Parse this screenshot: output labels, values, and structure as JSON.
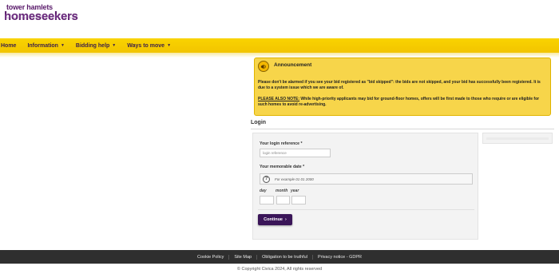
{
  "brand": {
    "logo_top": "tower hamlets",
    "logo_main": "homeseekers",
    "accent": "#f7c900",
    "brand_purple": "#5a1b6b"
  },
  "nav": {
    "items": [
      {
        "label": "Home",
        "has_dropdown": false
      },
      {
        "label": "Information",
        "has_dropdown": true
      },
      {
        "label": "Bidding help",
        "has_dropdown": true
      },
      {
        "label": "Ways to move",
        "has_dropdown": true
      }
    ]
  },
  "announcement": {
    "title": "Announcement",
    "paragraph1": "Please don't be alarmed if you see your bid registered as \"bid skipped\": the bids are not skipped, and your bid has successfully been registered. It is due to a system issue which we are aware of.",
    "paragraph2_lead": "PLEASE ALSO NOTE:",
    "paragraph2_rest": " While high-priority applicants may bid for ground-floor homes, offers will be first made to those who require or are eligible for such homes to avoid re-advertising."
  },
  "login": {
    "title": "Login",
    "reference_label": "Your login reference *",
    "reference_placeholder": "login reference",
    "date_label": "Your memorable date *",
    "date_hint": "For example 01 01 2000",
    "day_label": "day",
    "month_label": "month",
    "year_label": "year",
    "continue_label": "Continue"
  },
  "footer": {
    "links": [
      "Cookie Policy",
      "Site Map",
      "Obligation to be truthful",
      "Privacy notice - GDPR"
    ],
    "copyright": "© Copyright Civica 2024, All rights reserved"
  }
}
